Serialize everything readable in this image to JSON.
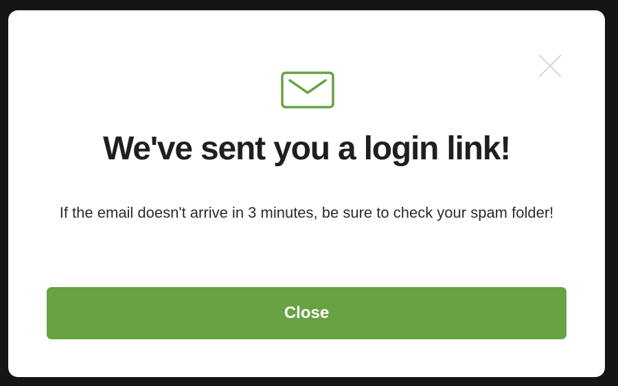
{
  "dialog": {
    "title": "We've sent you a login link!",
    "message": "If the email doesn't arrive in 3 minutes, be sure to check your spam folder!",
    "close_button_label": "Close",
    "icon": "envelope-icon",
    "close_icon": "close-icon"
  },
  "colors": {
    "accent": "#67a243",
    "backdrop": "#151515",
    "title": "#1f1f1f",
    "close_icon": "#d8d8d8"
  }
}
